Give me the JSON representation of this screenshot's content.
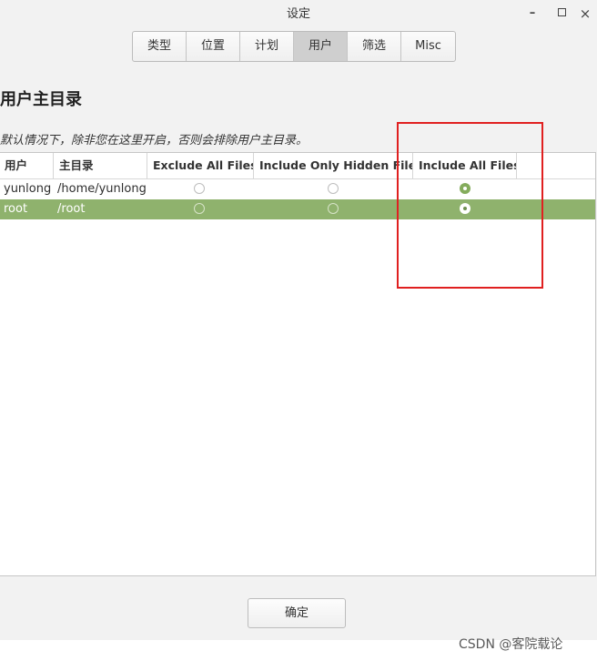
{
  "window": {
    "title": "设定",
    "minimize": "–",
    "close": "×"
  },
  "tabs": [
    "类型",
    "位置",
    "计划",
    "用户",
    "筛选",
    "Misc"
  ],
  "active_tab": "用户",
  "section": {
    "title": "用户主目录",
    "description": "默认情况下，除非您在这里开启，否则会排除用户主目录。"
  },
  "table": {
    "columns": [
      "用户",
      "主目录",
      "Exclude All Files",
      "Include Only Hidden Files",
      "Include All Files"
    ],
    "rows": [
      {
        "user": "yunlong",
        "home": "/home/yunlong",
        "choice": "Include All Files"
      },
      {
        "user": "root",
        "home": "/root",
        "choice": "Include All Files"
      }
    ],
    "selected_row": "root"
  },
  "footer": {
    "ok_label": "确定"
  },
  "watermark": "CSDN @客院载论",
  "colors": {
    "selection": "#8fb26d",
    "radio_on": "#84ac5c",
    "annotation": "#e02020"
  }
}
